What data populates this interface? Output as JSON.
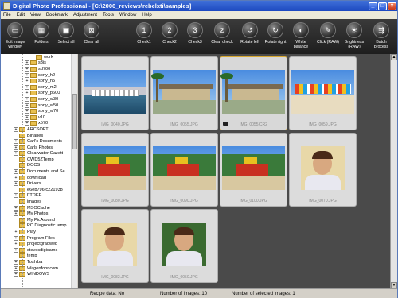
{
  "window": {
    "title": "Digital Photo Professional - [C:\\2006_reviews\\rebelxti\\samples]"
  },
  "menu": [
    "File",
    "Edit",
    "View",
    "Bookmark",
    "Adjustment",
    "Tools",
    "Window",
    "Help"
  ],
  "toolbar": [
    {
      "label": "Edit image window",
      "icon": "edit-image-icon",
      "glyph": "▭"
    },
    {
      "label": "Folders",
      "icon": "folders-icon",
      "glyph": "▦"
    },
    {
      "label": "Select all",
      "icon": "select-all-icon",
      "glyph": "▣"
    },
    {
      "label": "Clear all",
      "icon": "clear-all-icon",
      "glyph": "⊠"
    },
    {
      "label": "Check1",
      "icon": "check1-icon",
      "glyph": "1"
    },
    {
      "label": "Check2",
      "icon": "check2-icon",
      "glyph": "2"
    },
    {
      "label": "Check3",
      "icon": "check3-icon",
      "glyph": "3"
    },
    {
      "label": "Clear check",
      "icon": "clear-check-icon",
      "glyph": "⊘"
    },
    {
      "label": "Rotate left",
      "icon": "rotate-left-icon",
      "glyph": "↺"
    },
    {
      "label": "Rotate right",
      "icon": "rotate-right-icon",
      "glyph": "↻"
    },
    {
      "label": "White balance",
      "icon": "white-balance-icon",
      "glyph": "◐"
    },
    {
      "label": "Click (RAW)",
      "icon": "click-raw-icon",
      "glyph": "✎"
    },
    {
      "label": "Brightness (RAW)",
      "icon": "brightness-raw-icon",
      "glyph": "☀"
    },
    {
      "label": "Batch process",
      "icon": "batch-process-icon",
      "glyph": "⇶"
    }
  ],
  "tree": [
    {
      "label": "work",
      "indent": 5,
      "exp": false
    },
    {
      "label": "s3is",
      "indent": 4,
      "exp": true
    },
    {
      "label": "sd700",
      "indent": 4,
      "exp": true
    },
    {
      "label": "sony_h2",
      "indent": 4,
      "exp": true
    },
    {
      "label": "sony_h5",
      "indent": 4,
      "exp": true
    },
    {
      "label": "sony_m2",
      "indent": 4,
      "exp": true
    },
    {
      "label": "sony_p600",
      "indent": 4,
      "exp": true
    },
    {
      "label": "sony_w30",
      "indent": 4,
      "exp": true
    },
    {
      "label": "sony_w50",
      "indent": 4,
      "exp": true
    },
    {
      "label": "sony_w70",
      "indent": 4,
      "exp": true
    },
    {
      "label": "v10",
      "indent": 4,
      "exp": true
    },
    {
      "label": "x570",
      "indent": 4,
      "exp": true
    },
    {
      "label": "ARCSOFT",
      "indent": 2,
      "exp": true
    },
    {
      "label": "Binaries",
      "indent": 2,
      "exp": false
    },
    {
      "label": "Carl's Documents",
      "indent": 2,
      "exp": true
    },
    {
      "label": "Carls Photos",
      "indent": 2,
      "exp": true
    },
    {
      "label": "Clearwater Gazett",
      "indent": 2,
      "exp": true
    },
    {
      "label": "CWD5ZTemp",
      "indent": 2,
      "exp": false
    },
    {
      "label": "DOCS",
      "indent": 2,
      "exp": false
    },
    {
      "label": "Documents and Se",
      "indent": 2,
      "exp": true
    },
    {
      "label": "download",
      "indent": 2,
      "exp": true
    },
    {
      "label": "Drivers",
      "indent": 2,
      "exp": true
    },
    {
      "label": "e6eb796fc221938",
      "indent": 2,
      "exp": false
    },
    {
      "label": "FTREE",
      "indent": 2,
      "exp": true
    },
    {
      "label": "images",
      "indent": 2,
      "exp": false
    },
    {
      "label": "MSOCache",
      "indent": 2,
      "exp": true
    },
    {
      "label": "My Photos",
      "indent": 2,
      "exp": true
    },
    {
      "label": "My PicAround",
      "indent": 2,
      "exp": false
    },
    {
      "label": "PC Diagnostic.temp",
      "indent": 2,
      "exp": false
    },
    {
      "label": "Play",
      "indent": 2,
      "exp": true
    },
    {
      "label": "Program Files",
      "indent": 2,
      "exp": true
    },
    {
      "label": "projectgradweb",
      "indent": 2,
      "exp": true
    },
    {
      "label": "stevesdigicams",
      "indent": 2,
      "exp": true
    },
    {
      "label": "temp",
      "indent": 2,
      "exp": false
    },
    {
      "label": "Toshiba",
      "indent": 2,
      "exp": true
    },
    {
      "label": "Wagenfohr.com",
      "indent": 2,
      "exp": true
    },
    {
      "label": "WINDOWS",
      "indent": 2,
      "exp": true
    }
  ],
  "thumbnails": [
    {
      "filename": "IMG_0040.JPG",
      "scene": "harbor",
      "selected": false,
      "raw": false
    },
    {
      "filename": "IMG_0055.JPG",
      "scene": "building",
      "selected": false,
      "raw": false
    },
    {
      "filename": "IMG_0055.CR2",
      "scene": "building",
      "selected": true,
      "raw": true
    },
    {
      "filename": "IMG_0059.JPG",
      "scene": "beach",
      "selected": false,
      "raw": false
    },
    {
      "filename": "IMG_0080.JPG",
      "scene": "playground",
      "selected": false,
      "raw": false
    },
    {
      "filename": "IMG_0090.JPG",
      "scene": "playground",
      "selected": false,
      "raw": false
    },
    {
      "filename": "IMG_0100.JPG",
      "scene": "playground",
      "selected": false,
      "raw": false
    },
    {
      "filename": "IMG_0070.JPG",
      "scene": "portrait",
      "selected": false,
      "raw": false
    },
    {
      "filename": "IMG_0082.JPG",
      "scene": "portrait",
      "selected": false,
      "raw": false
    },
    {
      "filename": "IMG_0050.JPG",
      "scene": "portrait-green",
      "selected": false,
      "raw": false
    }
  ],
  "status": {
    "recipe": "Recipe data: No",
    "count": "Number of images: 10",
    "selected": "Number of selected images: 1"
  }
}
